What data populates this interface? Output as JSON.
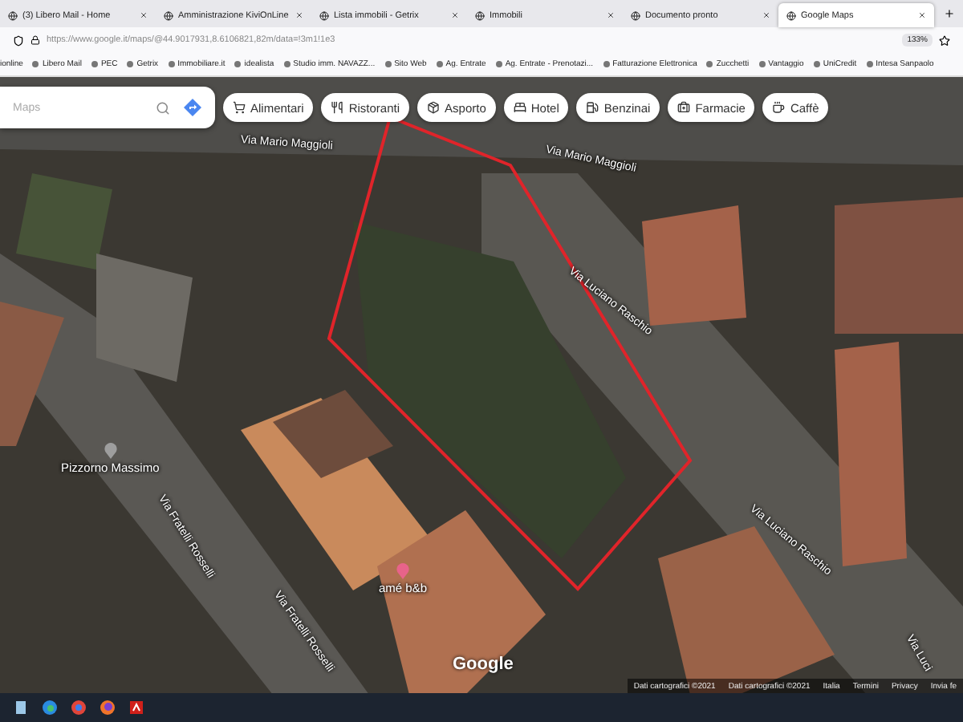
{
  "browser": {
    "tabs": [
      {
        "title": "(3) Libero Mail - Home",
        "selected": false
      },
      {
        "title": "Amministrazione KiviOnLine",
        "selected": false
      },
      {
        "title": "Lista immobili - Getrix",
        "selected": false
      },
      {
        "title": "Immobili",
        "selected": false
      },
      {
        "title": "Documento pronto",
        "selected": false
      },
      {
        "title": "Google Maps",
        "selected": true
      }
    ],
    "address": {
      "url": "https://www.google.it/maps/@44.9017931,8.6106821,82m/data=!3m1!1e3",
      "zoom": "133%"
    },
    "bookmarks": [
      "ionline",
      "Libero Mail",
      "PEC",
      "Getrix",
      "Immobiliare.it",
      "idealista",
      "Studio imm. NAVAZZ...",
      "Sito Web",
      "Ag. Entrate",
      "Ag. Entrate - Prenotazi...",
      "Fatturazione Elettronica",
      "Zucchetti",
      "Vantaggio",
      "UniCredit",
      "Intesa Sanpaolo"
    ]
  },
  "map": {
    "search": {
      "placeholder": "Maps"
    },
    "chips": [
      {
        "label": "Alimentari",
        "kind": "cart"
      },
      {
        "label": "Ristoranti",
        "kind": "restaurant"
      },
      {
        "label": "Asporto",
        "kind": "takeaway"
      },
      {
        "label": "Hotel",
        "kind": "hotel"
      },
      {
        "label": "Benzinai",
        "kind": "fuel"
      },
      {
        "label": "Farmacie",
        "kind": "pharmacy"
      },
      {
        "label": "Caffè",
        "kind": "cafe"
      }
    ],
    "street_labels": [
      "Via Mario Maggioli",
      "Via Mario Maggioli",
      "Via Luciano Raschio",
      "Via Luciano Raschio",
      "Via Luci",
      "Via Fratelli Rosselli",
      "Via Fratelli Rosselli"
    ],
    "places": [
      {
        "name": "Pizzorno Massimo",
        "color": "#9e9e9e"
      },
      {
        "name": "amé b&b",
        "color": "#e8638a"
      }
    ],
    "logo": "Google",
    "attribution": [
      "Dati cartografici ©2021",
      "Dati cartografici ©2021",
      "Italia",
      "Termini",
      "Privacy",
      "Invia fe"
    ]
  }
}
